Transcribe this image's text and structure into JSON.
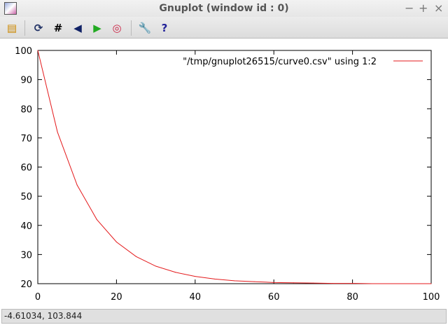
{
  "window": {
    "title": "Gnuplot (window id : 0)",
    "controls": {
      "minimize": "−",
      "maximize": "+",
      "close": "×"
    }
  },
  "toolbar": {
    "icons": [
      "copy-to-clipboard-icon",
      "replot-icon",
      "grid-icon",
      "zoom-previous-icon",
      "zoom-next-icon",
      "autoscale-icon",
      "settings-icon",
      "help-icon"
    ]
  },
  "status": {
    "coords": "-4.61034,  103.844"
  },
  "chart_data": {
    "type": "line",
    "title": "",
    "xlabel": "",
    "ylabel": "",
    "xlim": [
      0,
      100
    ],
    "ylim": [
      20,
      100
    ],
    "xticks": [
      "0",
      "20",
      "40",
      "60",
      "80",
      "100"
    ],
    "yticks": [
      "20",
      "30",
      "40",
      "50",
      "60",
      "70",
      "80",
      "90",
      "100"
    ],
    "grid": false,
    "legend": {
      "position": "top-right",
      "entries": [
        "\"/tmp/gnuplot26515/curve0.csv\" using 1:2"
      ]
    },
    "series": [
      {
        "name": "\"/tmp/gnuplot26515/curve0.csv\" using 1:2",
        "color": "#e41a1c",
        "x": [
          0,
          5,
          10,
          15,
          20,
          25,
          30,
          35,
          40,
          45,
          50,
          55,
          60,
          65,
          70,
          75,
          80,
          85,
          90,
          95,
          100
        ],
        "y": [
          100,
          72,
          53.8,
          42,
          34.3,
          29.3,
          26,
          23.9,
          22.5,
          21.6,
          21,
          20.7,
          20.4,
          20.3,
          20.2,
          20.1,
          20.1,
          20,
          20,
          20,
          20
        ]
      }
    ]
  }
}
